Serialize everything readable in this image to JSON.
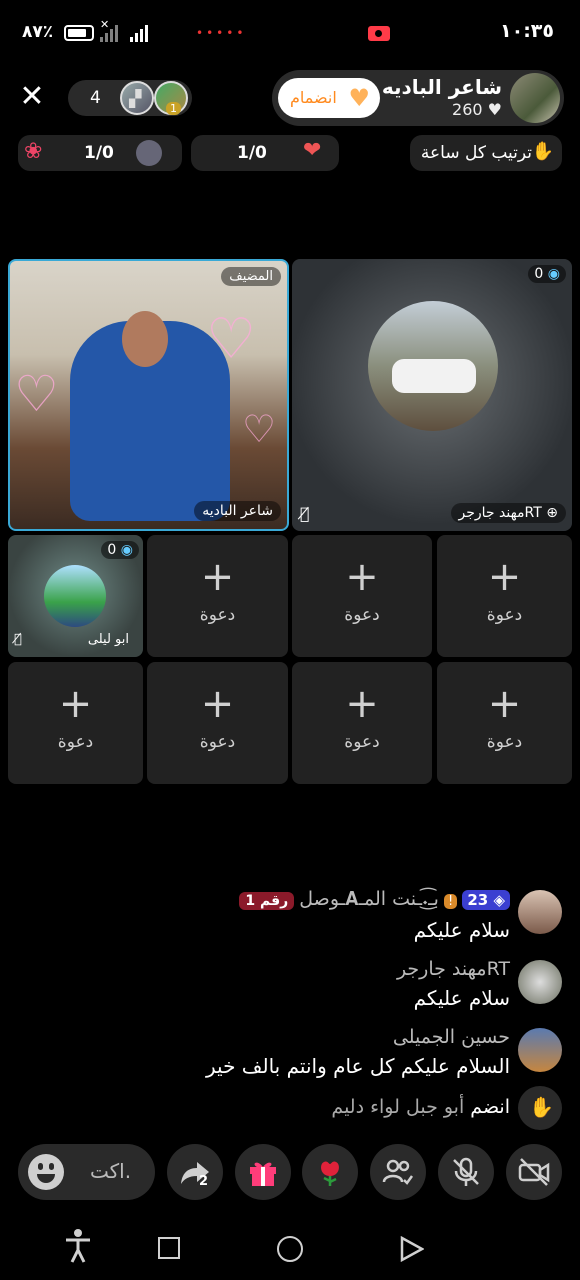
{
  "status": {
    "time": "١٠:٣٥",
    "battery": "٨٧٪"
  },
  "header": {
    "viewer_count": "4",
    "viewer_badge": "1",
    "host_name": "شاعر الباديه",
    "host_likes": "260",
    "join_label": "انضمام"
  },
  "ranking": {
    "label": "ترتيب كل ساعة",
    "pill1_value": "1/0",
    "pill2_value": "1/0"
  },
  "seats": {
    "host_tag": "المضيف",
    "host_name": "شاعر الباديه",
    "guest1_name": "مهند جارجرRT",
    "guest1_score": "0",
    "guest2_name": "ابو ليلى",
    "guest2_score": "0",
    "invite_label": "دعوة",
    "invite_plus": "+"
  },
  "chat": [
    {
      "name": "بـ͜͡𝆺ـنت المـ𝐀ـوصل",
      "level": "23",
      "badge": "رقم 1",
      "msg": "سلام عليكم"
    },
    {
      "name": "مهند جارجرRT",
      "msg": "سلام عليكم"
    },
    {
      "name": "حسين الجميلى",
      "msg": "السلام عليكم كل عام وانتم بالف خير"
    }
  ],
  "join_notice": {
    "prefix": "انضم",
    "user": "أبو جبل لواء دليم"
  },
  "bottom": {
    "comment_placeholder": "اكت.",
    "share_count": "2"
  },
  "colors": {
    "accent": "#ff8a1e",
    "record": "#ff3b48",
    "level_badge": "#3b3fd1",
    "rank_badge": "#8b1a2a"
  }
}
